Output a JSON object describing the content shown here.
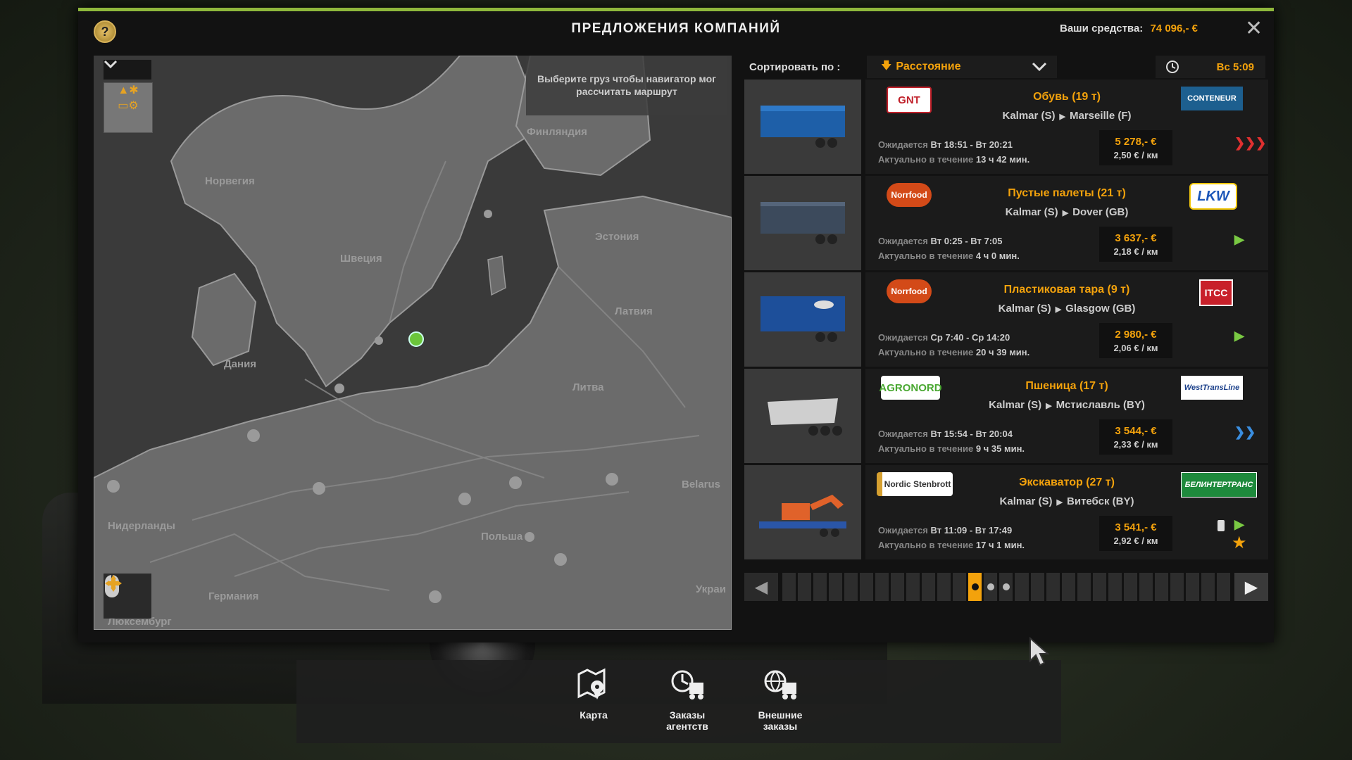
{
  "header": {
    "title": "ПРЕДЛОЖЕНИЯ КОМПАНИЙ",
    "help": "?",
    "funds_label": "Ваши средства:",
    "funds_value": "74 096,- €",
    "close": "✕"
  },
  "map": {
    "hint": "Выберите груз чтобы навигатор мог рассчитать маршрут",
    "labels": [
      "Норвегия",
      "Финляндия",
      "Швеция",
      "Эстония",
      "Латвия",
      "Дания",
      "Литва",
      "Belarus",
      "Нидерланды",
      "Польша",
      "Германия",
      "Люксембург",
      "Украи"
    ]
  },
  "sort": {
    "label": "Сортировать по :",
    "value": "Расстояние",
    "time": "Вс 5:09"
  },
  "offers": [
    {
      "company": "GNT",
      "company_color": "#c0202a",
      "cargo": "Обувь (19 т)",
      "from": "Kalmar (S)",
      "to": "Marseille (F)",
      "expect_label": "Ожидается",
      "expect": "Вт 18:51 - Вт 20:21",
      "valid_label": "Актуально в течение",
      "valid": "13 ч 42 мин.",
      "price": "5 278,- €",
      "rate": "2,50 € / км",
      "recipient": "CONTENEUR",
      "recipient_bg": "#1d5f8f",
      "mark": "❯❯❯",
      "mark_color": "#e03030"
    },
    {
      "company": "Norrfood",
      "company_color": "#d34a18",
      "cargo": "Пустые палеты (21 т)",
      "from": "Kalmar (S)",
      "to": "Dover (GB)",
      "expect_label": "Ожидается",
      "expect": "Вт 0:25 - Вт 7:05",
      "valid_label": "Актуально в течение",
      "valid": "4 ч 0 мин.",
      "price": "3 637,- €",
      "rate": "2,18 € / км",
      "recipient": "LKW",
      "recipient_bg": "#1a55b8",
      "mark": "▶",
      "mark_color": "#7ac943"
    },
    {
      "company": "Norrfood",
      "company_color": "#d34a18",
      "cargo": "Пластиковая тара (9 т)",
      "from": "Kalmar (S)",
      "to": "Glasgow (GB)",
      "expect_label": "Ожидается",
      "expect": "Ср 7:40 - Ср 14:20",
      "valid_label": "Актуально в течение",
      "valid": "20 ч 39 мин.",
      "price": "2 980,- €",
      "rate": "2,06 € / км",
      "recipient": "ITCC",
      "recipient_bg": "#c8202a",
      "mark": "▶",
      "mark_color": "#7ac943"
    },
    {
      "company": "AGRONORD",
      "company_color": "#4aa832",
      "cargo": "Пшеница (17 т)",
      "from": "Kalmar (S)",
      "to": "Мстиславль (BY)",
      "expect_label": "Ожидается",
      "expect": "Вт 15:54 - Вт 20:04",
      "valid_label": "Актуально в течение",
      "valid": "9 ч 35 мин.",
      "price": "3 544,- €",
      "rate": "2,33 € / км",
      "recipient": "WestTransLine",
      "recipient_bg": "#1a3f8a",
      "mark": "❯❯",
      "mark_color": "#3a8ee0"
    },
    {
      "company": "Nordic Stenbrott",
      "company_color": "#d6a030",
      "cargo": "Экскаватор (27 т)",
      "from": "Kalmar (S)",
      "to": "Витебск (BY)",
      "expect_label": "Ожидается",
      "expect": "Вт 11:09 - Вт 17:49",
      "valid_label": "Актуально в течение",
      "valid": "17 ч 1 мин.",
      "price": "3 541,- €",
      "rate": "2,92 € / км",
      "recipient": "БЕЛИНТЕРТРАНС",
      "recipient_bg": "#1e8a3c",
      "mark": "▶",
      "mark_color": "#7ac943",
      "special": "★"
    }
  ],
  "pager": {
    "prev": "◀",
    "next": "▶",
    "pages": 29,
    "active_index": 12,
    "dots": [
      12,
      13,
      14
    ]
  },
  "bottom_nav": [
    {
      "label": "Карта",
      "icon": "map-icon"
    },
    {
      "label": "Заказы агентств",
      "icon": "agency-orders-icon"
    },
    {
      "label": "Внешние заказы",
      "icon": "external-orders-icon"
    }
  ],
  "colors": {
    "accent": "#f3a20c",
    "header_bar": "#8fb83c",
    "panel": "#1b1b1b"
  }
}
